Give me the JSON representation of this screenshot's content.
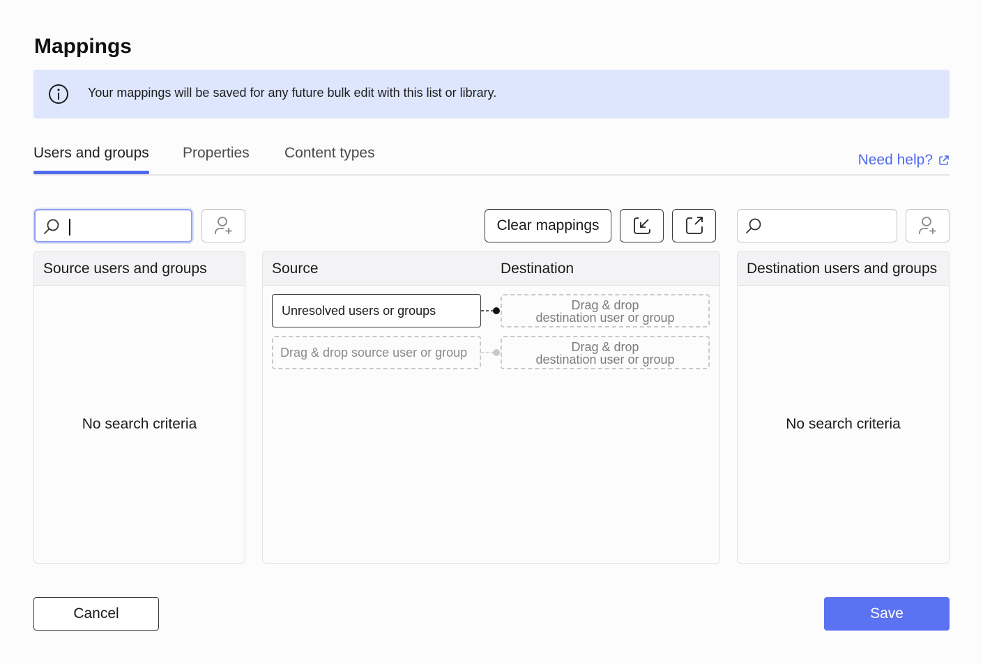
{
  "dialog": {
    "title": "Mappings"
  },
  "info": {
    "icon": "info-icon",
    "text": "Your mappings will be saved for any future bulk edit with this list or library."
  },
  "tabs": [
    {
      "label": "Users and groups",
      "active": true
    },
    {
      "label": "Properties",
      "active": false
    },
    {
      "label": "Content types",
      "active": false
    }
  ],
  "help": {
    "label": "Need help?",
    "icon": "external-link-icon"
  },
  "toolbar": {
    "clear_label": "Clear mappings",
    "import_icon": "import-icon",
    "export_icon": "export-icon",
    "add_user_icon": "add-user-icon",
    "search_icon": "search-icon"
  },
  "source_panel": {
    "header": "Source users and groups",
    "empty": "No search criteria"
  },
  "mapping_panel": {
    "source_header": "Source",
    "destination_header": "Destination",
    "rows": [
      {
        "source": "Unresolved users or groups",
        "destination_line1": "Drag & drop",
        "destination_line2": "destination user or group"
      },
      {
        "source": "Drag & drop source user or group",
        "destination_line1": "Drag & drop",
        "destination_line2": "destination user or group"
      }
    ]
  },
  "destination_panel": {
    "header": "Destination users and groups",
    "empty": "No search criteria"
  },
  "footer": {
    "cancel_label": "Cancel",
    "save_label": "Save"
  },
  "colors": {
    "accent": "#4f6bed",
    "info_bg": "#dde6fc",
    "save_bg": "#5b72f2"
  }
}
